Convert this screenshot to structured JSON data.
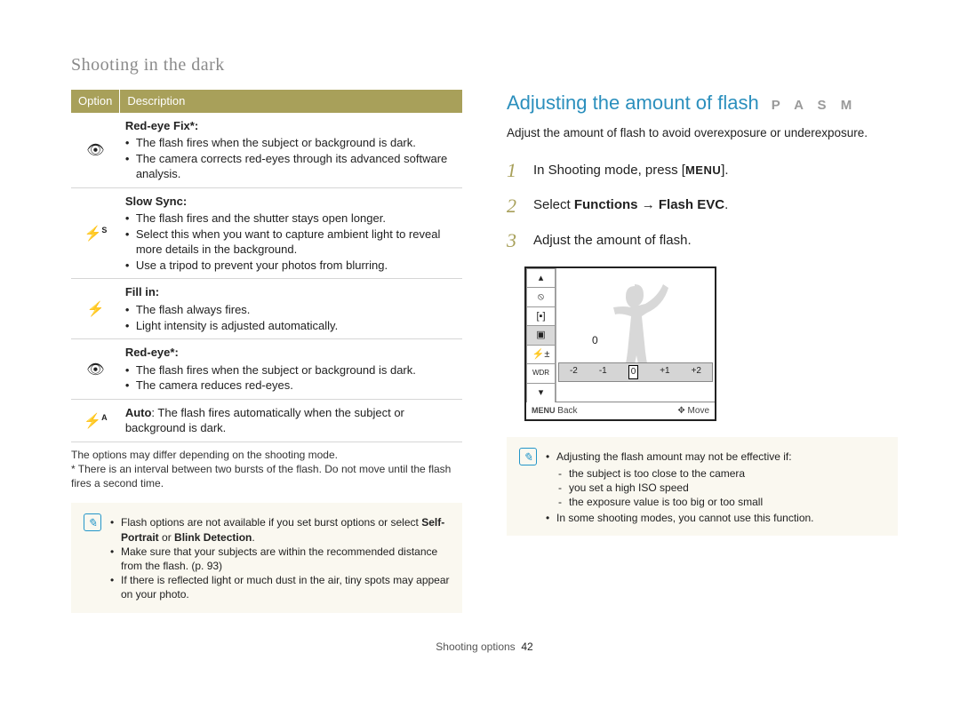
{
  "section_title": "Shooting in the dark",
  "table": {
    "head_option": "Option",
    "head_description": "Description",
    "rows": [
      {
        "icon": "red-eye-fix-icon",
        "title": "Red-eye Fix*:",
        "bullets": [
          "The flash fires when the subject or background is dark.",
          "The camera corrects red-eyes through its advanced software analysis."
        ]
      },
      {
        "icon": "slow-sync-icon",
        "title": "Slow Sync:",
        "bullets": [
          "The flash fires and the shutter stays open longer.",
          "Select this when you want to capture ambient light to reveal more details in the background.",
          "Use a tripod to prevent your photos from blurring."
        ]
      },
      {
        "icon": "fill-in-icon",
        "title": "Fill in:",
        "bullets": [
          "The flash always fires.",
          "Light intensity is adjusted automatically."
        ]
      },
      {
        "icon": "red-eye-icon",
        "title": "Red-eye*:",
        "bullets": [
          "The flash fires when the subject or background is dark.",
          "The camera reduces red-eyes."
        ]
      },
      {
        "icon": "auto-flash-icon",
        "title": "",
        "inline_bold": "Auto",
        "inline_text": ": The flash fires automatically when the subject or background is dark.",
        "bullets": []
      }
    ]
  },
  "left_footnotes": {
    "line1": "The options may differ depending on the shooting mode.",
    "line2": "* There is an interval between two bursts of the flash. Do not move until the flash fires a second time."
  },
  "left_note": {
    "bullets_a": "Flash options are not available if you set burst options or select ",
    "bullets_a_bold": "Self-Portrait",
    "bullets_a_mid": " or ",
    "bullets_a_bold2": "Blink Detection",
    "bullets_a_end": ".",
    "bullet_b": "Make sure that your subjects are within the recommended distance from the flash. (p. 93)",
    "bullet_c": "If there is reflected light or much dust in the air, tiny spots may appear on your photo."
  },
  "right": {
    "title": "Adjusting the amount of flash",
    "modes": "P A S M",
    "desc": "Adjust the amount of flash to avoid overexposure or underexposure.",
    "steps": {
      "s1_pre": "In Shooting mode, press [",
      "s1_badge": "MENU",
      "s1_post": "].",
      "s2_pre": "Select ",
      "s2_bold1": "Functions",
      "s2_arrow": " → ",
      "s2_bold2": "Flash EVC",
      "s2_post": ".",
      "s3": "Adjust the amount of flash."
    },
    "lcd": {
      "zero": "0",
      "ev_labels": [
        "-2",
        "-1",
        "0",
        "+1",
        "+2"
      ],
      "back_key": "MENU",
      "back_label": "Back",
      "move_label": "Move",
      "ev_icon_label": "⚡±"
    },
    "note": {
      "lead": "Adjusting the flash amount may not be effective if:",
      "sub": [
        "the subject is too close to the camera",
        "you set a high ISO speed",
        "the exposure value is too big or too small"
      ],
      "bullet2": "In some shooting modes, you cannot use this function."
    }
  },
  "footer": {
    "label": "Shooting options",
    "page": "42"
  }
}
